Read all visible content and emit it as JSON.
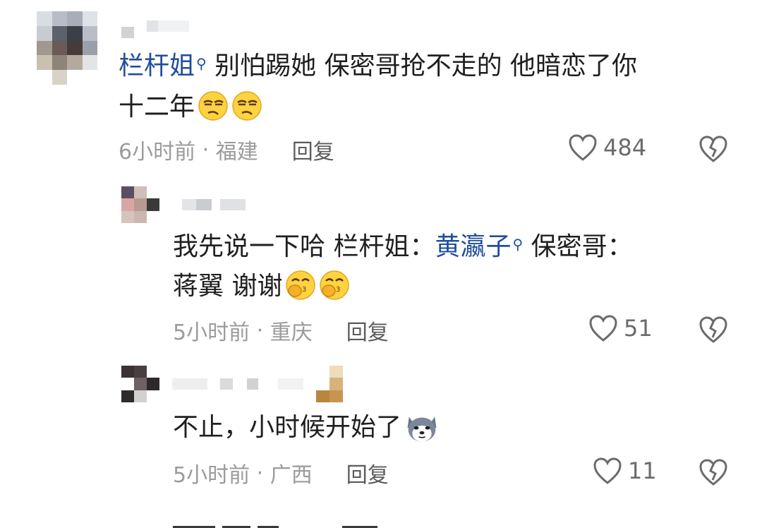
{
  "colors": {
    "link": "#1f4e9c",
    "meta": "#9b9b9b",
    "text": "#1f1f1f"
  },
  "comments": [
    {
      "mention": "栏杆姐",
      "text": "别怕踢她 保密哥抢不走的 他暗恋了你",
      "text_line2": "十二年",
      "emojis": [
        "smirk-emoji",
        "smirk-emoji"
      ],
      "time": "6小时前",
      "location": "福建",
      "reply_label": "回复",
      "likes": "484"
    },
    {
      "text_part1": "我先说一下哈 栏杆姐：",
      "mention": "黄瀛子",
      "text_part2": " 保密哥：",
      "text_line2": "蒋翼  谢谢",
      "emojis": [
        "blush-hand-emoji",
        "blush-hand-emoji"
      ],
      "time": "5小时前",
      "location": "重庆",
      "reply_label": "回复",
      "likes": "51"
    },
    {
      "text": "不止，小时候开始了",
      "emojis": [
        "husky-emoji"
      ],
      "time": "5小时前",
      "location": "广西",
      "reply_label": "回复",
      "likes": "11"
    }
  ]
}
